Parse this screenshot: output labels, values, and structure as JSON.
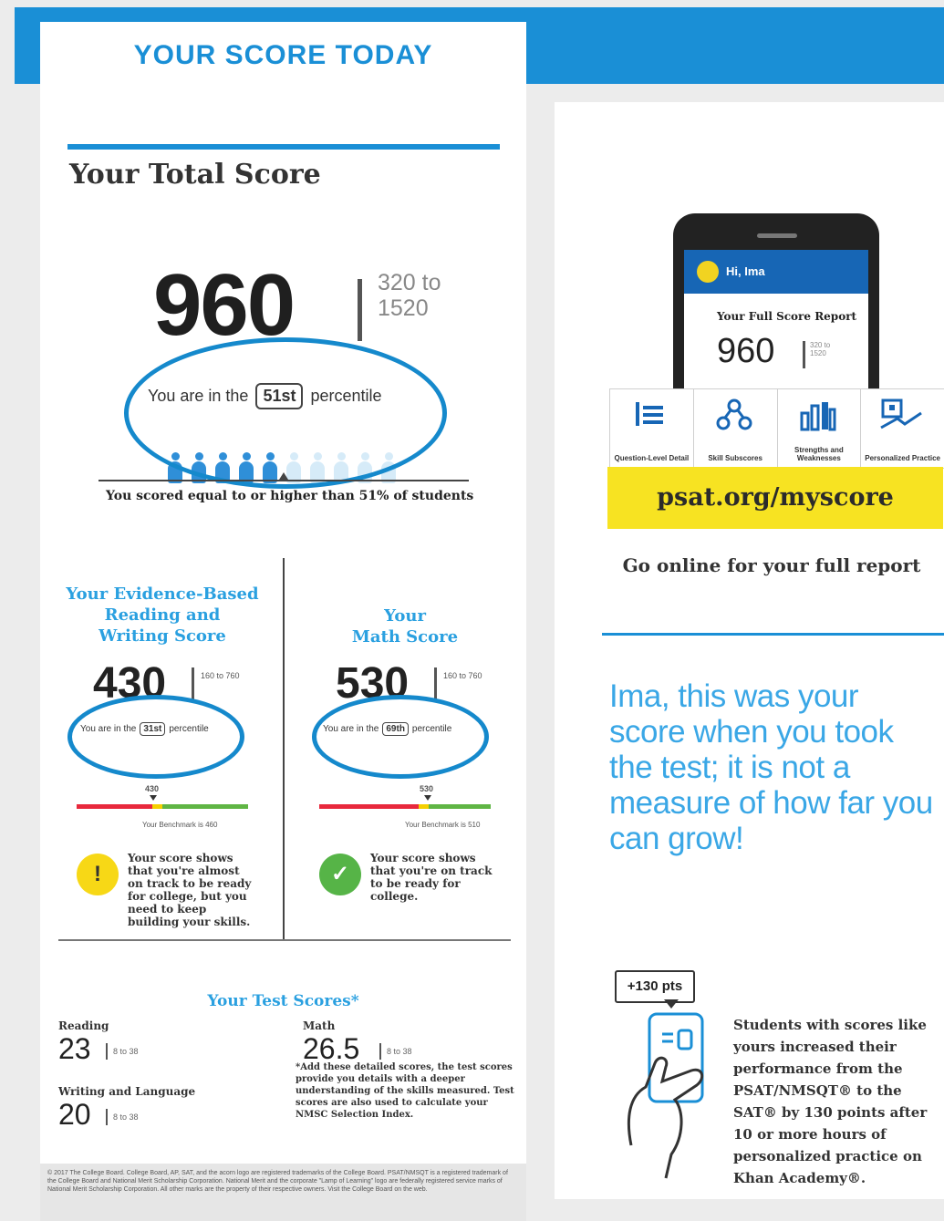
{
  "header": {
    "title": "YOUR SCORE TODAY"
  },
  "total": {
    "heading": "Your Total Score",
    "score": "960",
    "range_top": "320 to",
    "range_bottom": "1520",
    "pct_prefix": "You are in the",
    "percentile": "51st",
    "pct_suffix": "percentile",
    "percentile_value": 51,
    "caption": "You scored equal to or higher than 51% of students"
  },
  "ebrw": {
    "title_lines": [
      "Your Evidence-Based",
      "Reading and",
      "Writing Score"
    ],
    "score": "430",
    "range": "160 to 760",
    "pct_prefix": "You are in the",
    "percentile": "31st",
    "pct_suffix": "percentile",
    "marker_label": "430",
    "scale_label": "Your Benchmark is 460",
    "message": "Your score shows that you're almost on track to be ready for college, but you need to keep building your skills."
  },
  "math": {
    "title_lines": [
      "Your",
      "Math Score"
    ],
    "score": "530",
    "range": "160 to 760",
    "pct_prefix": "You are in the",
    "percentile": "69th",
    "pct_suffix": "percentile",
    "marker_label": "530",
    "scale_label": "Your Benchmark is 510",
    "message": "Your score shows that you're on track to be ready for college."
  },
  "test_scores": {
    "heading": "Your Test Scores*",
    "reading_label": "Reading",
    "reading": "23",
    "writing_label": "Writing and Language",
    "writing": "20",
    "math_label": "Math",
    "math": "26.5",
    "range": "8 to 38",
    "footnote": "*Add these detailed scores, the test scores provide you details with a deeper understanding of the skills measured. Test scores are also used to calculate your NMSC Selection Index."
  },
  "legal": "© 2017 The College Board. College Board, AP, SAT, and the acorn logo are registered trademarks of the College Board. PSAT/NMSQT is a registered trademark of the College Board and National Merit Scholarship Corporation. National Merit and the corporate \"Lamp of Learning\" logo are federally registered service marks of National Merit Scholarship Corporation. All other marks are the property of their respective owners. Visit the College Board on the web.",
  "phone": {
    "greeting": "Hi, Ima",
    "report_title": "Your Full Score Report",
    "score": "960",
    "range": "320 to 1520"
  },
  "icons": [
    {
      "label": "Question-Level Detail",
      "icon": "checklist-icon"
    },
    {
      "label": "Skill Subscores",
      "icon": "hierarchy-icon"
    },
    {
      "label": "Strengths and Weaknesses",
      "icon": "bar-chart-icon"
    },
    {
      "label": "Personalized Practice",
      "icon": "practice-icon"
    }
  ],
  "online": {
    "url": "psat.org/myscore",
    "text": "Go online for your full report"
  },
  "message": "Ima, this was your score when you took the test; it is not a measure of how far you can grow!",
  "khan": {
    "badge": "+130 pts",
    "text": "Students with scores like yours increased their performance from the PSAT/NMSQT® to the SAT® by 130 points after 10 or more hours of personalized practice on Khan Academy®."
  },
  "colors": {
    "accent": "#1a8fd6",
    "text_blue": "#3aa7e6",
    "yellow": "#f7e322",
    "scale_red": "#e8283c",
    "scale_yellow": "#f5d000",
    "scale_green": "#5fb544"
  }
}
